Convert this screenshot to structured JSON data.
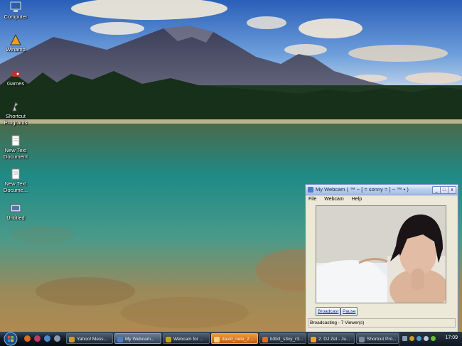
{
  "desktop_icons": [
    {
      "label": "Computer",
      "icon": "computer-icon"
    },
    {
      "label": "Winamp",
      "icon": "winamp-icon"
    },
    {
      "label": "Games",
      "icon": "games-icon"
    },
    {
      "label": "Shortcut Programs",
      "icon": "shortcut-icon"
    },
    {
      "label": "New Text Document",
      "icon": "text-document-icon"
    },
    {
      "label": "New Text Docume...",
      "icon": "text-document-icon"
    },
    {
      "label": "Untitled",
      "icon": "untitled-icon"
    }
  ],
  "webcam_window": {
    "title": "My Webcam ( ™ ~ [ = sonny = ] ~ ™ • )",
    "menu": [
      "File",
      "Webcam",
      "Help"
    ],
    "broadcast_label": "Broadcast",
    "pause_label": "Pause",
    "status": "Broadcasting - 7 Viewer(s)",
    "minimize": "_",
    "maximize": "□",
    "close": "x"
  },
  "taskbar": {
    "tasks": [
      {
        "label": "Yahoo! Mess...",
        "color": "#c8a020"
      },
      {
        "label": "My Webcam...",
        "color": "#4a7dc4"
      },
      {
        "label": "Webcam for ...",
        "color": "#c8a020"
      },
      {
        "label": "david_nela_2...",
        "color": "#e06a20"
      },
      {
        "label": "b3b3_s3xy_r3...",
        "color": "#e06a20"
      },
      {
        "label": "2. DJ Zet - Ju...",
        "color": "#e8a030"
      },
      {
        "label": "Shortcut Pro...",
        "color": "#7a8898"
      }
    ],
    "clock": "17:09"
  },
  "colors": {
    "taskbar": "#141c26",
    "window_border": "#6c8cc4"
  }
}
